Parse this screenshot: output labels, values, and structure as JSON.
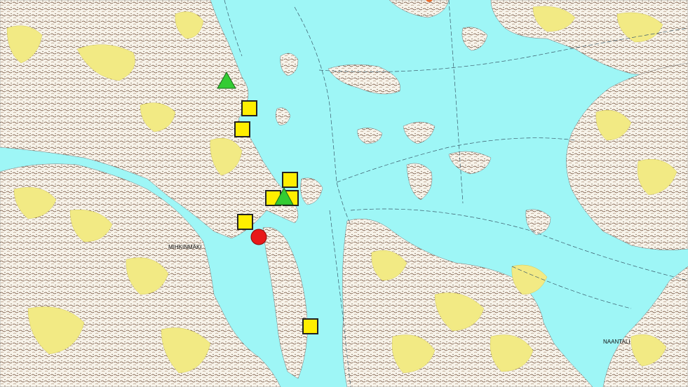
{
  "map": {
    "colors": {
      "water": "#9ef6f6",
      "land": "#f7f3ea",
      "field": "#f2ea84",
      "relief": "#6a4630",
      "marker_square": "#ffee00",
      "marker_triangle": "#33cc33",
      "marker_circle": "#e8191a"
    },
    "place_labels": [
      "MIHKINMÄKI",
      "NAANTALI"
    ],
    "markers": {
      "squares": 8,
      "triangles": 2,
      "circles": 1
    }
  }
}
